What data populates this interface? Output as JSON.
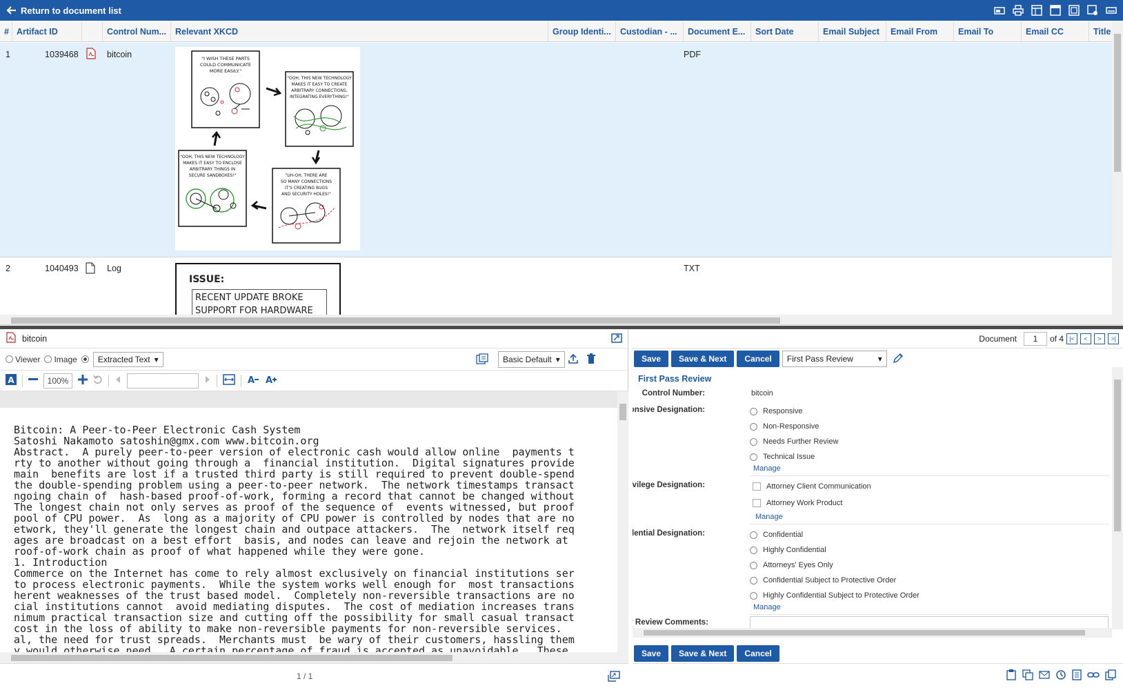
{
  "topbar": {
    "back_label": "Return to document list",
    "icons": [
      "workspace-icon",
      "print-icon",
      "layout-icon",
      "window-icon",
      "panel-icon",
      "settings-icon",
      "minimize-icon"
    ]
  },
  "grid": {
    "columns": [
      "#",
      "Artifact ID",
      "",
      "Control Num...",
      "Relevant XKCD",
      "Group Identi...",
      "Custodian - ...",
      "Document E...",
      "Sort Date",
      "Email Subject",
      "Email From",
      "Email To",
      "Email CC",
      "Title"
    ],
    "rows": [
      {
        "num": "1",
        "artifact_id": "1039468",
        "file_icon": "pdf-icon",
        "control": "bitcoin",
        "doc_ext": "PDF"
      },
      {
        "num": "2",
        "artifact_id": "1040493",
        "file_icon": "text-file-icon",
        "control": "Log",
        "doc_ext": "TXT"
      }
    ],
    "comic1_panels": [
      "\"I WISH THESE PARTS COULD COMMUNICATE MORE EASILY.\"",
      "\"OOH, THIS NEW TECHNOLOGY MAKES IT EASY TO CREATE ARBITRARY CONNECTIONS, INTEGRATING EVERYTHING!\"",
      "\"UH-OH, THERE ARE SO MANY CONNECTIONS IT'S CREATING BUGS AND SECURITY HOLES!\"",
      "\"OOH, THIS NEW TECHNOLOGY MAKES IT EASY TO ENCLOSE ARBITRARY THINGS IN SECURE SANDBOXES!\""
    ],
    "comic2": {
      "title": "ISSUE:",
      "line1": "RECENT UPDATE BROKE",
      "line2": "SUPPORT FOR HARDWARE"
    }
  },
  "viewer": {
    "doc_title": "bitcoin",
    "modes": [
      "Viewer",
      "Image",
      "Extracted Text"
    ],
    "selected_mode": "Extracted Text",
    "profile": "Basic Default",
    "zoom": "100%",
    "page_indicator": "1 / 1",
    "text": "Bitcoin: A Peer-to-Peer Electronic Cash System\nSatoshi Nakamoto satoshin@gmx.com www.bitcoin.org\nAbstract.  A purely peer-to-peer version of electronic cash would allow online  payments t\nrty to another without going through a  financial institution.  Digital signatures provide\nmain  benefits are lost if a trusted third party is still required to prevent double-spend\nthe double-spending problem using a peer-to-peer network.  The network timestamps transact\nngoing chain of  hash-based proof-of-work, forming a record that cannot be changed without\nThe longest chain not only serves as proof of the sequence of  events witnessed, but proof\npool of CPU power.  As  long as a majority of CPU power is controlled by nodes that are no\network, they'll generate the longest chain and outpace attackers.  The  network itself req\nages are broadcast on a best effort  basis, and nodes can leave and rejoin the network at\nroof-of-work chain as proof of what happened while they were gone.\n1. Introduction\nCommerce on the Internet has come to rely almost exclusively on financial institutions ser\nto process electronic payments.  While the system works well enough for  most transactions\nherent weaknesses of the trust based model.  Completely non-reversible transactions are no\ncial institutions cannot  avoid mediating disputes.  The cost of mediation increases trans\nnimum practical transaction size and cutting off the possibility for small casual transact\ncost in the loss of ability to make non-reversible payments for non-reversible services.\nal, the need for trust spreads.  Merchants must  be wary of their customers, hassling them\ny would otherwise need.  A certain percentage of fraud is accepted as unavoidable.  These"
  },
  "coding": {
    "document_label": "Document",
    "document_number": "1",
    "document_of": "of 4",
    "save": "Save",
    "save_next": "Save & Next",
    "cancel": "Cancel",
    "layout": "First Pass Review",
    "section_title": "First Pass Review",
    "control_label": "Control Number:",
    "control_value": "bitcoin",
    "responsive_label": "Responsive Designation:",
    "responsive_options": [
      "Responsive",
      "Non-Responsive",
      "Needs Further Review",
      "Technical Issue"
    ],
    "privilege_label": "Privilege Designation:",
    "privilege_options": [
      "Attorney Client Communication",
      "Attorney Work Product"
    ],
    "confidential_label": "Confidential Designation:",
    "confidential_options": [
      "Confidential",
      "Highly Confidential",
      "Attorneys' Eyes Only",
      "Confidential Subject to Protective Order",
      "Highly Confidential Subject to Protective Order"
    ],
    "manage": "Manage",
    "comments_label": "Attorney Review Comments:"
  },
  "colors": {
    "accent": "#1f5aa6",
    "selected_row": "#e1f0fb",
    "splitter": "#4a4a4a"
  }
}
